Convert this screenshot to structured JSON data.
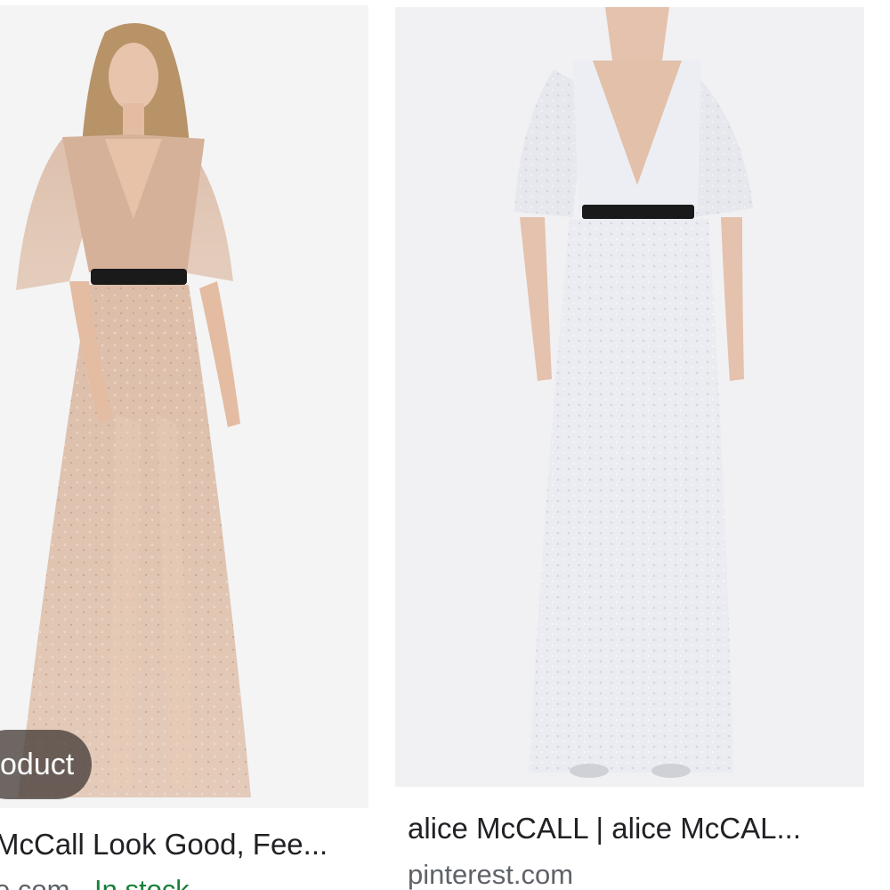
{
  "results": [
    {
      "image_alt": "Model wearing a sheer nude sequin gown with black waist belt",
      "badge": "oduct",
      "title": "McCall Look Good, Fee...",
      "source": "e.com",
      "separator": " · ",
      "availability": "In stock",
      "colors": {
        "dress": "#d7b49e",
        "belt": "#1a1a1a",
        "background": "#f4f4f5"
      }
    },
    {
      "image_alt": "Model wearing a white lace gown with black waist belt",
      "title": "alice McCALL | alice McCAL...",
      "source": "pinterest.com",
      "colors": {
        "dress": "#eceef3",
        "belt": "#1a1a1a",
        "background": "#f1f1f3"
      }
    }
  ]
}
